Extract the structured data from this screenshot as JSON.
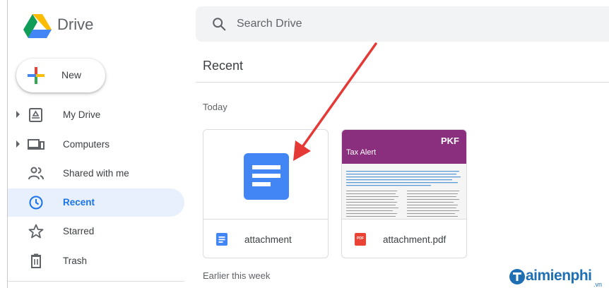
{
  "header": {
    "app_title": "Drive",
    "search_placeholder": "Search Drive"
  },
  "new_button": {
    "label": "New"
  },
  "sidebar": {
    "items": [
      {
        "label": "My Drive",
        "icon": "my-drive-icon",
        "expandable": true
      },
      {
        "label": "Computers",
        "icon": "computers-icon",
        "expandable": true
      },
      {
        "label": "Shared with me",
        "icon": "shared-icon",
        "expandable": false
      },
      {
        "label": "Recent",
        "icon": "clock-icon",
        "expandable": false,
        "active": true
      },
      {
        "label": "Starred",
        "icon": "star-icon",
        "expandable": false
      },
      {
        "label": "Trash",
        "icon": "trash-icon",
        "expandable": false
      }
    ]
  },
  "main": {
    "title": "Recent",
    "sections": [
      {
        "label": "Today"
      },
      {
        "label": "Earlier this week"
      }
    ],
    "files": [
      {
        "name": "attachment",
        "type": "google-doc",
        "thumbnail_icon": "docs-icon"
      },
      {
        "name": "attachment.pdf",
        "type": "pdf",
        "thumbnail_brand": "PKF",
        "thumbnail_heading": "Tax Alert",
        "file_icon_text": "PDF"
      }
    ]
  },
  "watermark": {
    "text": "aimienphi",
    "sub": ".vn"
  },
  "colors": {
    "accent": "#1a73e8",
    "active_bg": "#e8f0fe",
    "docs_blue": "#4285f4",
    "pdf_red": "#ea4335",
    "pdf_banner": "#8a2f7e",
    "arrow": "#e53935"
  }
}
